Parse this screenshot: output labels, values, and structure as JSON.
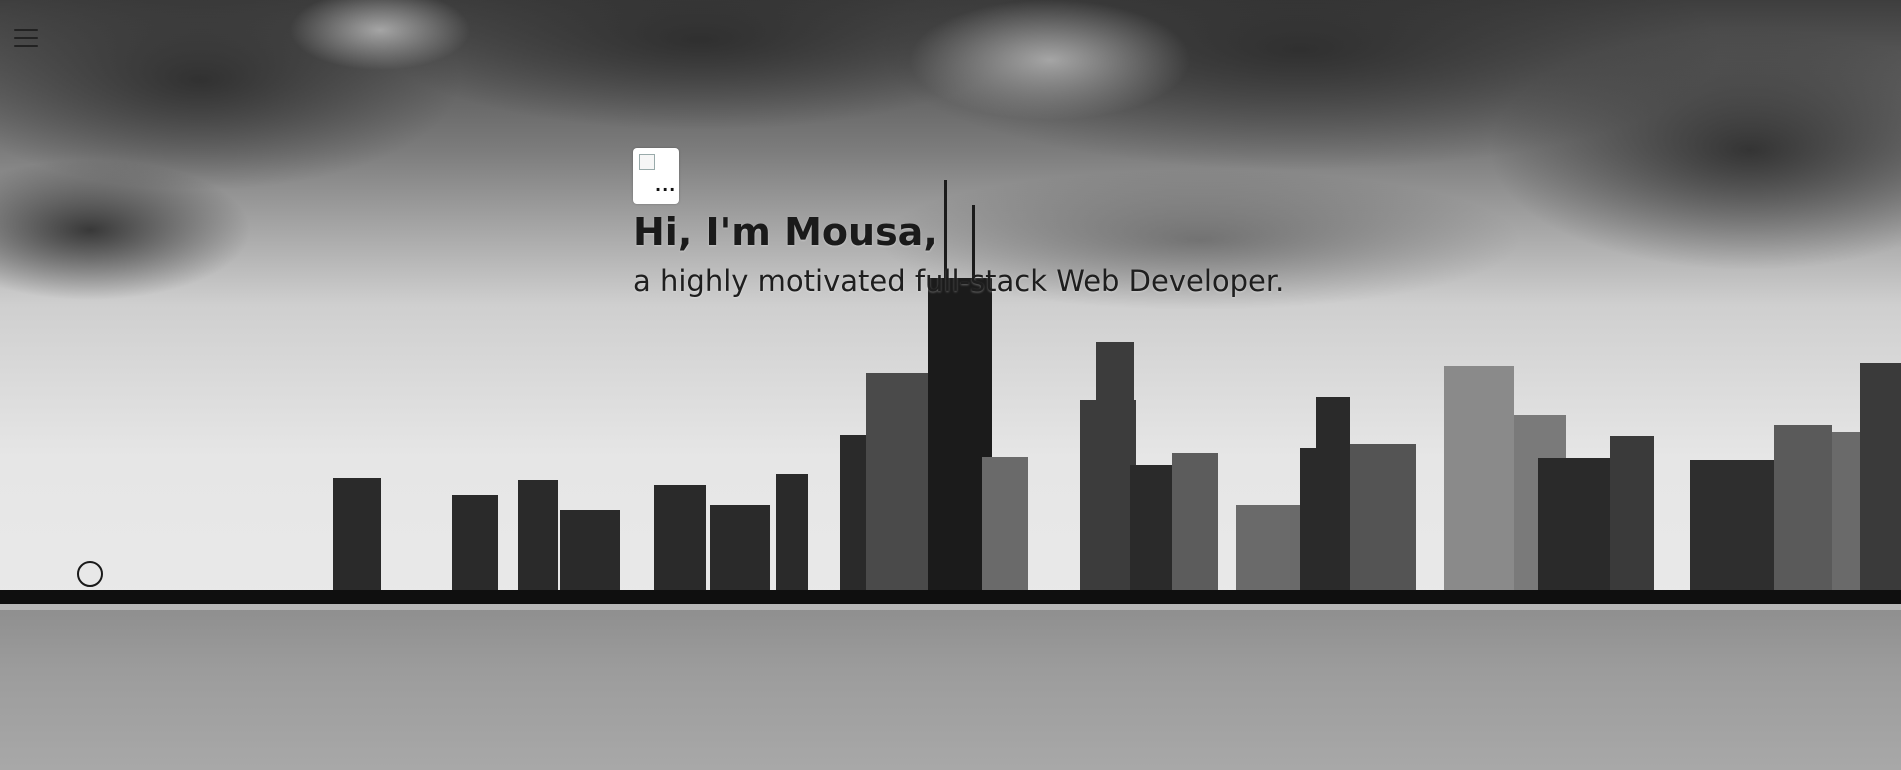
{
  "menu": {
    "icon": "hamburger-menu-icon"
  },
  "hero": {
    "avatar_alt": "...",
    "greeting": "Hi, I'm Mousa,",
    "tagline": "a highly motivated full-stack Web Developer."
  },
  "colors": {
    "text": "#1e1e1e",
    "avatar_bg": "#ffffff"
  }
}
